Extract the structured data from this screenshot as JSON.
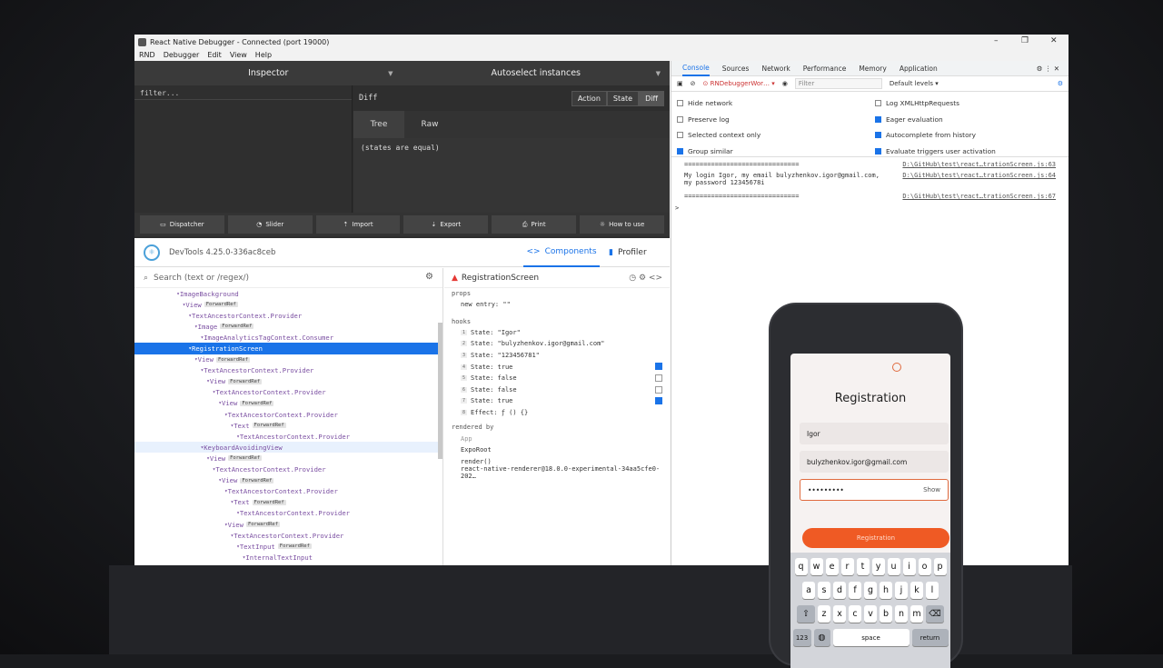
{
  "window": {
    "title": "React Native Debugger - Connected (port 19000)",
    "controls": [
      "–",
      "❐",
      "✕"
    ]
  },
  "menu": [
    "RND",
    "Debugger",
    "Edit",
    "View",
    "Help"
  ],
  "redux": {
    "inspector_label": "Inspector",
    "autoselect_label": "Autoselect instances",
    "filter_placeholder": "filter...",
    "diff_label": "Diff",
    "mode_buttons": [
      "Action",
      "State",
      "Diff"
    ],
    "view_tabs": [
      "Tree",
      "Raw"
    ],
    "diff_text": "(states are equal)",
    "toolbar": [
      "Dispatcher",
      "Slider",
      "Import",
      "Export",
      "Print",
      "How to use"
    ]
  },
  "devtools": {
    "version": "DevTools 4.25.0-336ac8ceb",
    "tabs": [
      "Components",
      "Profiler"
    ],
    "search_placeholder": "Search (text or /regex/)",
    "tree": [
      {
        "name": "ImageBackground",
        "badge": "",
        "indent": 7,
        "state": ""
      },
      {
        "name": "View",
        "badge": "ForwardRef",
        "indent": 8,
        "state": ""
      },
      {
        "name": "TextAncestorContext.Provider",
        "badge": "",
        "indent": 9,
        "state": ""
      },
      {
        "name": "Image",
        "badge": "ForwardRef",
        "indent": 10,
        "state": ""
      },
      {
        "name": "ImageAnalyticsTagContext.Consumer",
        "badge": "",
        "indent": 11,
        "state": ""
      },
      {
        "name": "RegistrationScreen",
        "badge": "",
        "indent": 9,
        "state": "sel"
      },
      {
        "name": "View",
        "badge": "ForwardRef",
        "indent": 10,
        "state": ""
      },
      {
        "name": "TextAncestorContext.Provider",
        "badge": "",
        "indent": 11,
        "state": ""
      },
      {
        "name": "View",
        "badge": "ForwardRef",
        "indent": 12,
        "state": ""
      },
      {
        "name": "TextAncestorContext.Provider",
        "badge": "",
        "indent": 13,
        "state": ""
      },
      {
        "name": "View",
        "badge": "ForwardRef",
        "indent": 14,
        "state": ""
      },
      {
        "name": "TextAncestorContext.Provider",
        "badge": "",
        "indent": 15,
        "state": ""
      },
      {
        "name": "Text",
        "badge": "ForwardRef",
        "indent": 16,
        "state": ""
      },
      {
        "name": "TextAncestorContext.Provider",
        "badge": "",
        "indent": 17,
        "state": ""
      },
      {
        "name": "KeyboardAvoidingView",
        "badge": "",
        "indent": 11,
        "state": "hov"
      },
      {
        "name": "View",
        "badge": "ForwardRef",
        "indent": 12,
        "state": ""
      },
      {
        "name": "TextAncestorContext.Provider",
        "badge": "",
        "indent": 13,
        "state": ""
      },
      {
        "name": "View",
        "badge": "ForwardRef",
        "indent": 14,
        "state": ""
      },
      {
        "name": "TextAncestorContext.Provider",
        "badge": "",
        "indent": 15,
        "state": ""
      },
      {
        "name": "Text",
        "badge": "ForwardRef",
        "indent": 16,
        "state": ""
      },
      {
        "name": "TextAncestorContext.Provider",
        "badge": "",
        "indent": 17,
        "state": ""
      },
      {
        "name": "View",
        "badge": "ForwardRef",
        "indent": 15,
        "state": ""
      },
      {
        "name": "TextAncestorContext.Provider",
        "badge": "",
        "indent": 16,
        "state": ""
      },
      {
        "name": "TextInput",
        "badge": "ForwardRef",
        "indent": 17,
        "state": ""
      },
      {
        "name": "InternalTextInput",
        "badge": "",
        "indent": 18,
        "state": ""
      }
    ],
    "selected": {
      "name": "RegistrationScreen",
      "props_label": "props",
      "props": [
        "new entry: \"\""
      ],
      "hooks_label": "hooks",
      "hooks": [
        {
          "n": "1",
          "text": "State: \"Igor\"",
          "cb": ""
        },
        {
          "n": "2",
          "text": "State: \"bulyzhenkov.igor@gmail.com\"",
          "cb": ""
        },
        {
          "n": "3",
          "text": "State: \"123456781\"",
          "cb": ""
        },
        {
          "n": "4",
          "text": "State: true",
          "cb": "on"
        },
        {
          "n": "5",
          "text": "State: false",
          "cb": "off"
        },
        {
          "n": "6",
          "text": "State: false",
          "cb": "off"
        },
        {
          "n": "7",
          "text": "State: true",
          "cb": "on"
        },
        {
          "n": "8",
          "text": "Effect: ƒ () {}",
          "cb": ""
        }
      ],
      "rendered_by_label": "rendered by",
      "rendered_by": [
        "App",
        "ExpoRoot",
        "render()",
        "react-native-renderer@18.0.0-experimental-34aa5cfe0-202…"
      ]
    }
  },
  "console": {
    "tabs": [
      "Console",
      "Sources",
      "Network",
      "Performance",
      "Memory",
      "Application"
    ],
    "context": "RNDebuggerWor…",
    "filter_placeholder": "Filter",
    "levels": "Default levels ▾",
    "options_left": [
      {
        "label": "Hide network",
        "checked": false
      },
      {
        "label": "Preserve log",
        "checked": false
      },
      {
        "label": "Selected context only",
        "checked": false
      },
      {
        "label": "Group similar",
        "checked": true
      }
    ],
    "options_right": [
      {
        "label": "Log XMLHttpRequests",
        "checked": false
      },
      {
        "label": "Eager evaluation",
        "checked": true
      },
      {
        "label": "Autocomplete from history",
        "checked": true
      },
      {
        "label": "Evaluate triggers user activation",
        "checked": true
      }
    ],
    "messages": [
      {
        "text": "==============================",
        "src": "D:\\GitHub\\test\\react…trationScreen.js:63"
      },
      {
        "text": "My login Igor, my email bulyzhenkov.igor@gmail.com,\nmy password 12345678i",
        "src": "D:\\GitHub\\test\\react…trationScreen.js:64"
      },
      {
        "text": "==============================",
        "src": "D:\\GitHub\\test\\react…trationScreen.js:67"
      }
    ],
    "prompt": ">"
  },
  "phone": {
    "title": "Registration",
    "login": "Igor",
    "email": "bulyzhenkov.igor@gmail.com",
    "password": "•••••••••",
    "show": "Show",
    "button": "Registration",
    "keys_row1": [
      "q",
      "w",
      "e",
      "r",
      "t",
      "y",
      "u",
      "i",
      "o",
      "p"
    ],
    "keys_row2": [
      "a",
      "s",
      "d",
      "f",
      "g",
      "h",
      "j",
      "k",
      "l"
    ],
    "keys_row3": [
      "z",
      "x",
      "c",
      "v",
      "b",
      "n",
      "m"
    ],
    "key_123": "123",
    "key_space": "space",
    "key_return": "return",
    "accent": "#ef5a24"
  }
}
